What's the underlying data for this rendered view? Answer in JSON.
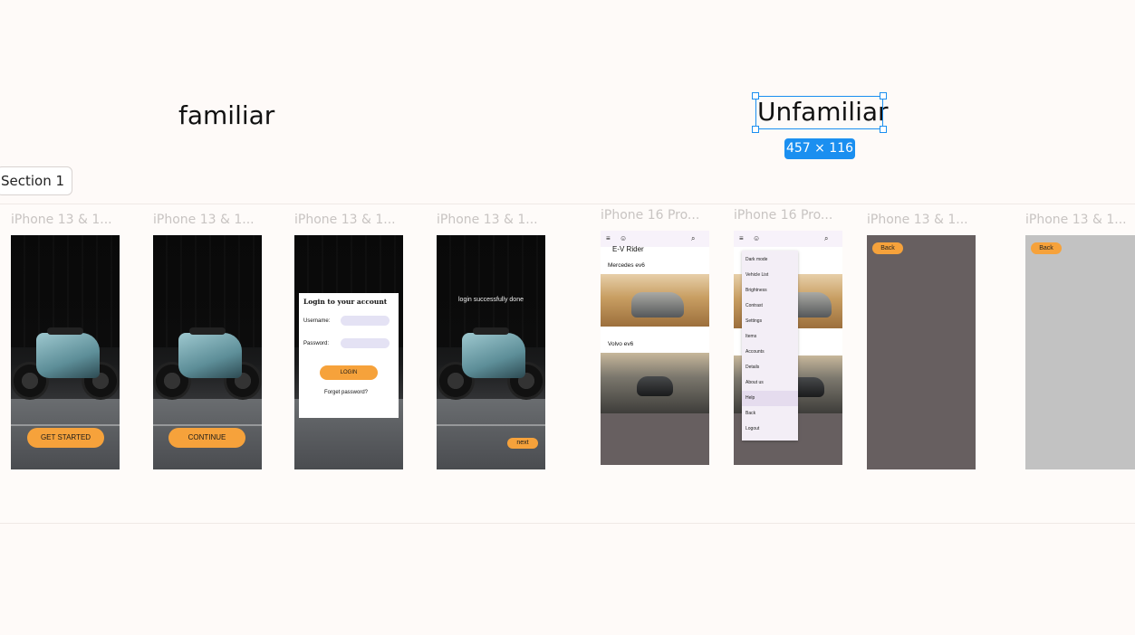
{
  "canvas": {
    "familiar_label": "familiar",
    "unfamiliar_label": "Unfamiliar",
    "selection_size": "457 × 116",
    "selection_color": "#1b8ff0"
  },
  "section": {
    "label": "Section 1"
  },
  "frames": {
    "f1": {
      "title": "iPhone 13 & 1...",
      "button": "GET STARTED"
    },
    "f2": {
      "title": "iPhone 13 & 1...",
      "button": "CONTINUE"
    },
    "f3": {
      "title": "iPhone 13 & 1...",
      "heading": "Login to your account",
      "username_label": "Username:",
      "password_label": "Password:",
      "button": "LOGIN",
      "forgot": "Forget password?"
    },
    "f4": {
      "title": "iPhone 13 & 1...",
      "message": "login successfully done",
      "button": "next"
    },
    "f5": {
      "title": "iPhone 16 Pro...",
      "app_title": "E-V Rider",
      "car1": "Mercedes ev6",
      "car2": "Volvo ev6"
    },
    "f6": {
      "title": "iPhone 16 Pro...",
      "menu": [
        "Dark mode",
        "Vehicle List",
        "Brightness",
        "Contrast",
        "Settings",
        "Items",
        "Accounts",
        "Details",
        "About us",
        "Help",
        "Back",
        "Logout"
      ],
      "active_item": "Help"
    },
    "f7": {
      "title": "iPhone 13 & 1...",
      "button": "Back",
      "bg": "#675f60"
    },
    "f8": {
      "title": "iPhone 13 & 1...",
      "button": "Back",
      "bg": "#c2c2c2"
    }
  },
  "colors": {
    "accent": "#f6a23b",
    "canvas_bg": "#fefaf8"
  }
}
